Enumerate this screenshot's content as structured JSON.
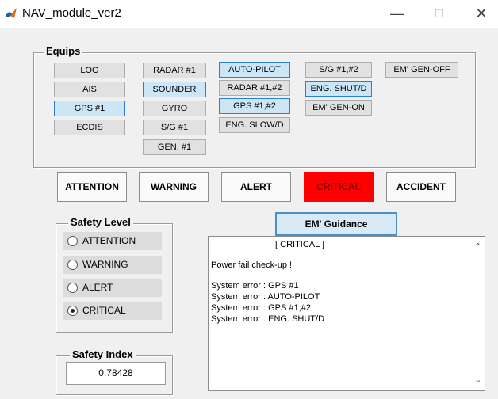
{
  "window": {
    "title": "NAV_module_ver2",
    "minimize": "—",
    "maximize": "☐",
    "close": "✕"
  },
  "equips": {
    "label": "Equips",
    "buttons": [
      "LOG",
      "AIS",
      "GPS #1",
      "ECDIS",
      "RADAR #1",
      "SOUNDER",
      "GYRO",
      "S/G #1",
      "GEN. #1",
      "AUTO-PILOT",
      "RADAR #1,#2",
      "GPS #1,#2",
      "ENG. SLOW/D",
      "S/G #1,#2",
      "ENG. SHUT/D",
      "EM' GEN-ON",
      "EM' GEN-OFF"
    ]
  },
  "status": {
    "buttons": [
      "ATTENTION",
      "WARNING",
      "ALERT",
      "CRITICAL",
      "ACCIDENT"
    ]
  },
  "safety_level": {
    "label": "Safety Level",
    "options": [
      "ATTENTION",
      "WARNING",
      "ALERT",
      "CRITICAL"
    ],
    "selected": "CRITICAL"
  },
  "guidance": {
    "button": "EM' Guidance",
    "header": "[ CRITICAL ]",
    "lines": [
      "Power fail check-up !",
      "",
      "System error : GPS #1",
      "System error : AUTO-PILOT",
      "System error : GPS #1,#2",
      "System error : ENG. SHUT/D"
    ]
  },
  "safety_index": {
    "label": "Safety Index",
    "value": "0.78428"
  },
  "colors": {
    "critical": "#ff0000",
    "active_border": "#2a7ed3",
    "active_fill": "#cde6f7"
  }
}
